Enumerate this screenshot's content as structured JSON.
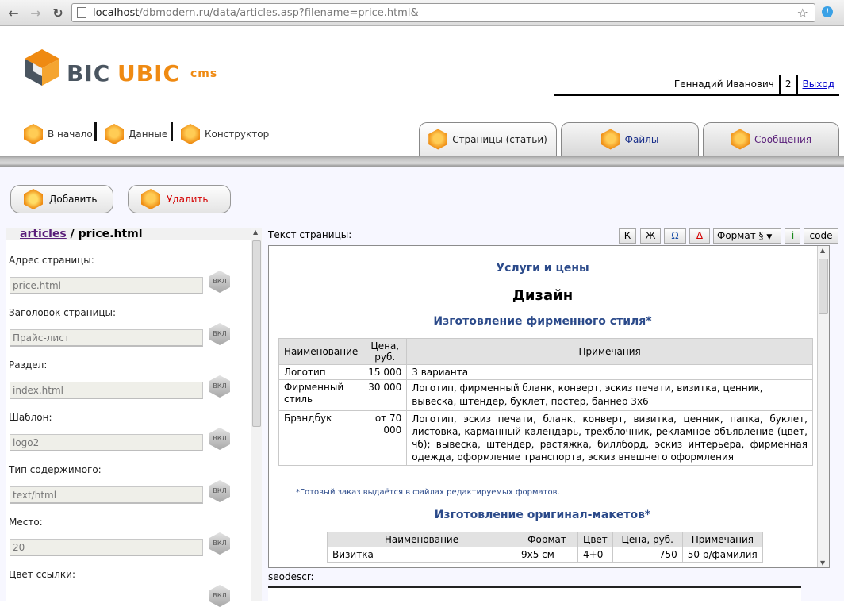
{
  "browser": {
    "url_host": "localhost",
    "url_path": "/dbmodern.ru/data/articles.asp?filename=price.html&"
  },
  "logo": {
    "part1": "BIC",
    "part2": "UBIC",
    "part3": "cms"
  },
  "user": {
    "name": "Геннадий Иванович",
    "count": "2",
    "logout": "Выход"
  },
  "topnav": [
    {
      "label": "В начало"
    },
    {
      "label": "Данные"
    },
    {
      "label": "Конструктор"
    }
  ],
  "tabs": [
    {
      "label": "Страницы (статьи)"
    },
    {
      "label": "Файлы"
    },
    {
      "label": "Сообщения"
    }
  ],
  "actions": {
    "add": "Добавить",
    "delete": "Удалить"
  },
  "breadcrumb": {
    "link": "articles",
    "sep": "/",
    "current": "price.html"
  },
  "fields": [
    {
      "label": "Адрес страницы:",
      "value": "price.html"
    },
    {
      "label": "Заголовок страницы:",
      "value": "Прайс-лист"
    },
    {
      "label": "Раздел:",
      "value": "index.html"
    },
    {
      "label": "Шаблон:",
      "value": "logo2"
    },
    {
      "label": "Тип содержимого:",
      "value": "text/html"
    },
    {
      "label": "Место:",
      "value": "20"
    },
    {
      "label": "Цвет ссылки:",
      "value": ""
    }
  ],
  "vkl_label": "ВКЛ",
  "editor": {
    "label": "Текст страницы:",
    "toolbar": {
      "bold": "К",
      "italic": "Ж",
      "omega": "Ω",
      "delta": "Δ",
      "format": "Формат §",
      "info": "i",
      "code": "code"
    },
    "h_services": "Услуги и цены",
    "h_design": "Дизайн",
    "h_brand": "Изготовление фирменного стиля*",
    "table1": {
      "headers": [
        "Наименование",
        "Цена, руб.",
        "Примечания"
      ],
      "rows": [
        [
          "Логотип",
          "15 000",
          "3 варианта"
        ],
        [
          "Фирменный стиль",
          "30 000",
          "Логотип, фирменный бланк, конверт, эскиз печати, визитка, ценник, вывеска, штендер, буклет, постер, баннер 3х6"
        ],
        [
          "Брэндбук",
          "от 70 000",
          "Логотип, эскиз печати, бланк, конверт, визитка, ценник, папка, буклет, листовка, карманный календарь, трехблочник, рекламное объявление (цвет, чб); вывеска, штендер, растяжка, биллборд, эскиз интерьера, фирменная одежда, оформление транспорта, эскиз внешнего оформления"
        ]
      ]
    },
    "note": "*Готовый заказ выдаётся в файлах редактируемых форматов.",
    "h_layouts": "Изготовление оригинал-макетов*",
    "table2": {
      "headers": [
        "Наименование",
        "Формат",
        "Цвет",
        "Цена, руб.",
        "Примечания"
      ],
      "rows": [
        [
          "Визитка",
          "9х5 см",
          "4+0",
          "750",
          "50 р/фамилия"
        ]
      ]
    }
  },
  "seo_label": "seodescr:"
}
